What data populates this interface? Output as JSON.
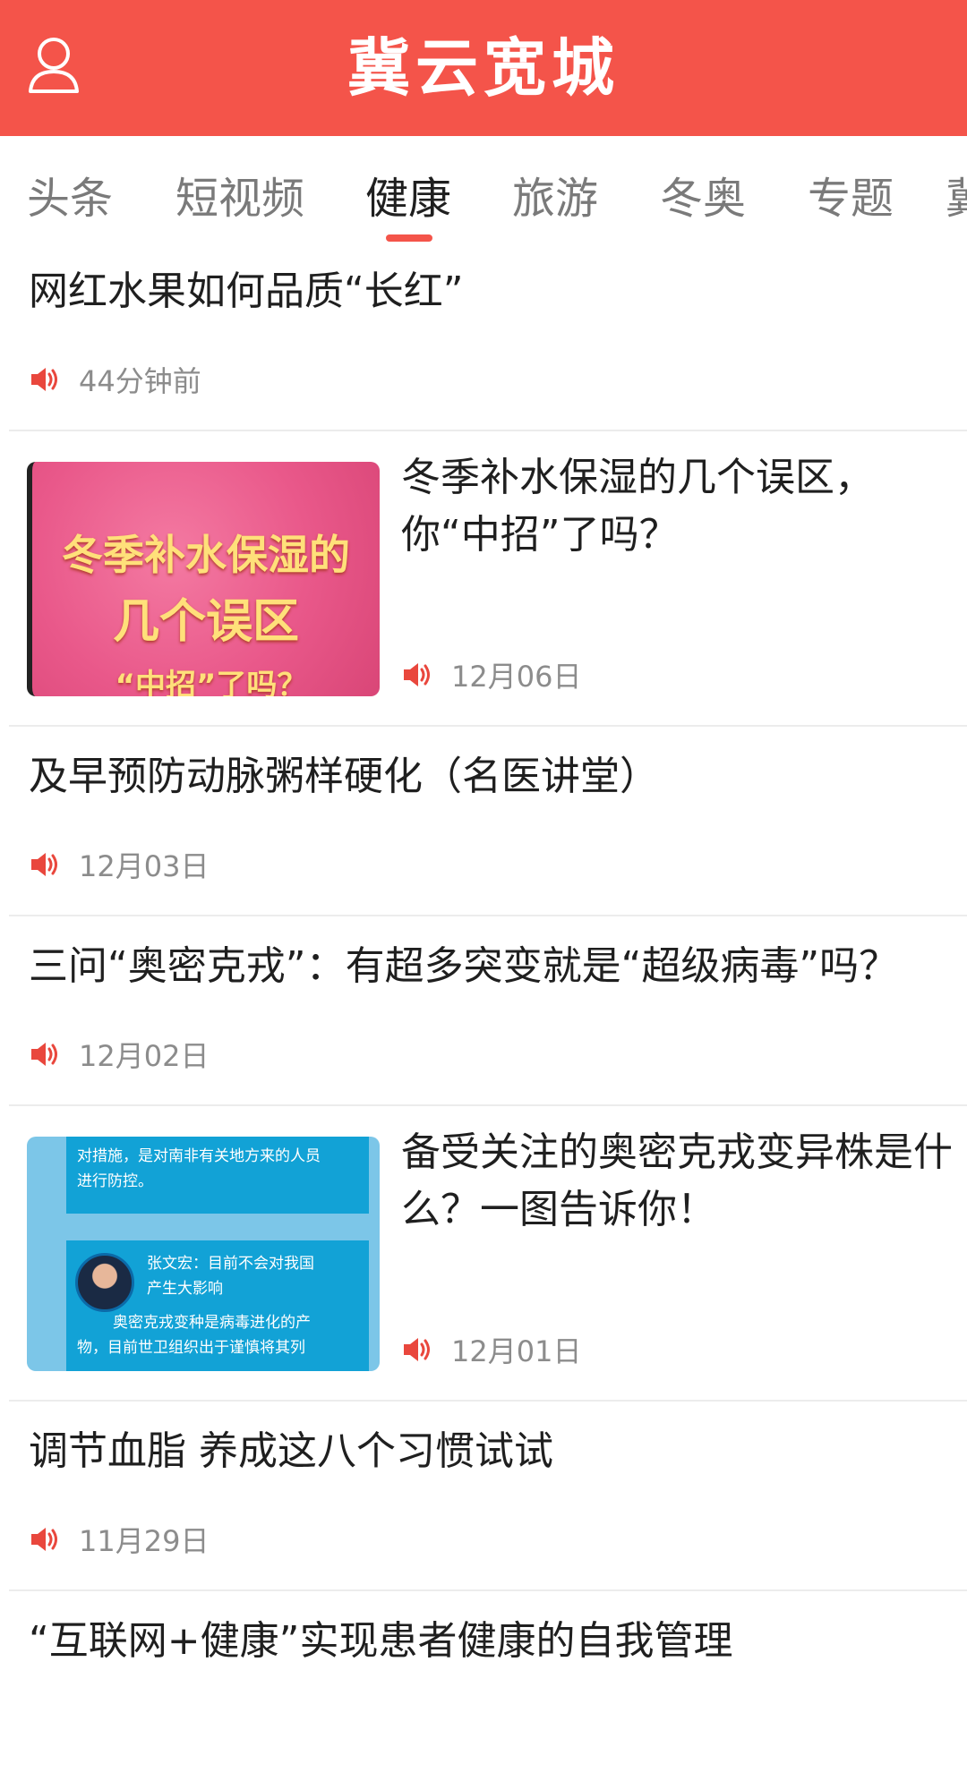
{
  "header": {
    "title": "冀云宽城",
    "user_icon": "user-icon",
    "bg_color": "#f4544a"
  },
  "tabs": [
    "头条",
    "短视频",
    "健康",
    "旅游",
    "冬奥",
    "专题",
    "冀"
  ],
  "active_tab": "健康",
  "feed": [
    {
      "title": "网红水果如何品质“长红”",
      "time": "44分钟前"
    },
    {
      "title_lines": [
        "冬季补水保湿的几个误区，",
        "你“中招”了吗？"
      ],
      "time": "12月06日",
      "thumb_text": [
        "冬季补水保湿的",
        "几个误区",
        "“中招”了吗？"
      ]
    },
    {
      "title": "及早预防动脉粥样硬化（名医讲堂）",
      "time": "12月03日"
    },
    {
      "title": "三问“奥密克戎”：有超多突变就是“超级病毒”吗？",
      "time": "12月02日"
    },
    {
      "title_lines": [
        "备受关注的奥密克戎变异株是什",
        "么？一图告诉你！"
      ],
      "time": "12月01日",
      "thumb_text": [
        "对措施，是对南非有关地方来的人员",
        "进行防控。",
        "张文宏：目前不会对我国",
        "产生大影响",
        "奥密克戎变种是病毒进化的产",
        "物，目前世卫组织出于谨慎将其列"
      ]
    },
    {
      "title": "调节血脂 养成这八个习惯试试",
      "time": "11月29日"
    },
    {
      "title": "“互联网+健康”实现患者健康的自我管理",
      "time": ""
    }
  ],
  "accent_color": "#f4544a",
  "speaker_icon": "speaker-icon"
}
